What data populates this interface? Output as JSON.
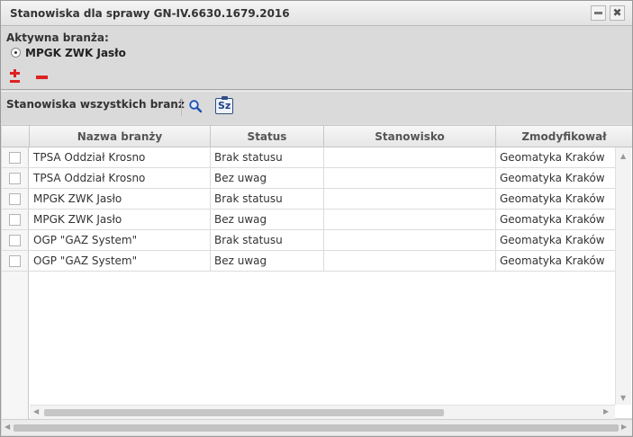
{
  "window": {
    "title": "Stanowiska dla sprawy GN-IV.6630.1679.2016",
    "minimize_icon": "minimize-icon",
    "close_icon": "close-icon",
    "close_glyph": "✖"
  },
  "branza": {
    "label": "Aktywna branża:",
    "selected": "MPGK ZWK Jasło",
    "add_icon": "plus-minus-icon",
    "remove_icon": "minus-icon"
  },
  "section": {
    "label": "Stanowiska wszystkich branż",
    "search_icon": "magnifier-icon",
    "sz_label": "Sz"
  },
  "table": {
    "columns": [
      "Nazwa branży",
      "Status",
      "Stanowisko",
      "Zmodyfikował"
    ],
    "rows": [
      [
        "TPSA Oddział Krosno",
        "Brak statusu",
        "",
        "Geomatyka Kraków"
      ],
      [
        "TPSA Oddział Krosno",
        "Bez uwag",
        "",
        "Geomatyka Kraków"
      ],
      [
        "MPGK ZWK Jasło",
        "Brak statusu",
        "",
        "Geomatyka Kraków"
      ],
      [
        "MPGK ZWK Jasło",
        "Bez uwag",
        "",
        "Geomatyka Kraków"
      ],
      [
        "OGP \"GAZ System\"",
        "Brak statusu",
        "",
        "Geomatyka Kraków"
      ],
      [
        "OGP \"GAZ System\"",
        "Bez uwag",
        "",
        "Geomatyka Kraków"
      ]
    ]
  },
  "colors": {
    "accent_red": "#dd2222",
    "header_bg": "#e6e6e6",
    "panel_bg": "#dadada"
  }
}
